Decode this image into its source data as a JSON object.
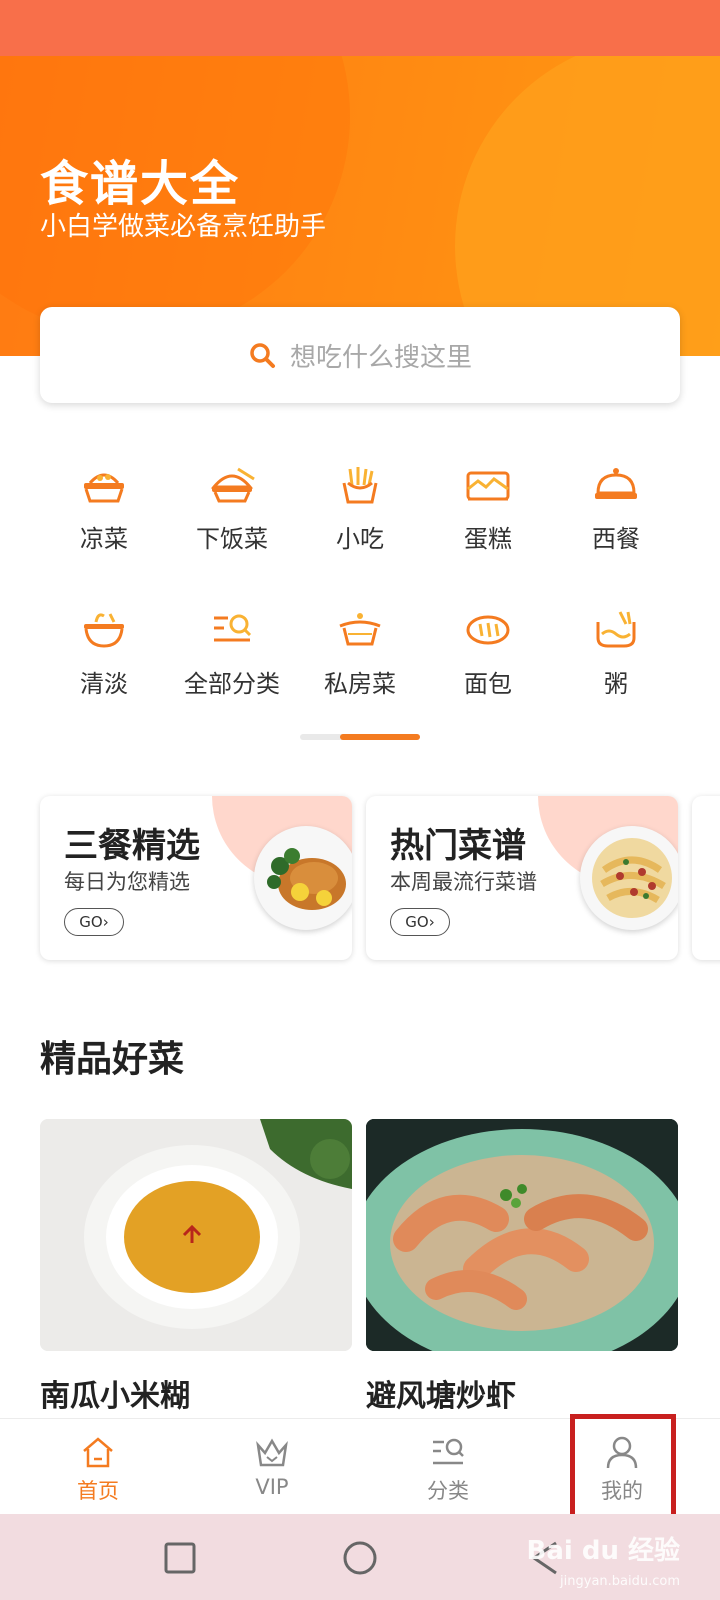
{
  "header": {
    "title": "食谱大全",
    "subtitle": "小白学做菜必备烹饪助手"
  },
  "search": {
    "placeholder": "想吃什么搜这里"
  },
  "categories": [
    {
      "label": "凉菜",
      "icon": "cold-dish-icon"
    },
    {
      "label": "下饭菜",
      "icon": "rice-dish-icon"
    },
    {
      "label": "小吃",
      "icon": "fries-snack-icon"
    },
    {
      "label": "蛋糕",
      "icon": "cake-icon"
    },
    {
      "label": "西餐",
      "icon": "cloche-icon"
    },
    {
      "label": "清淡",
      "icon": "light-bowl-icon"
    },
    {
      "label": "全部分类",
      "icon": "category-list-icon"
    },
    {
      "label": "私房菜",
      "icon": "pot-icon"
    },
    {
      "label": "面包",
      "icon": "bread-icon"
    },
    {
      "label": "粥",
      "icon": "porridge-icon"
    }
  ],
  "promos": [
    {
      "title": "三餐精选",
      "subtitle": "每日为您精选",
      "go": "GO›"
    },
    {
      "title": "热门菜谱",
      "subtitle": "本周最流行菜谱",
      "go": "GO›"
    }
  ],
  "featured": {
    "title": "精品好菜",
    "dishes": [
      {
        "name": "南瓜小米糊"
      },
      {
        "name": "避风塘炒虾"
      }
    ]
  },
  "tabbar": {
    "items": [
      {
        "label": "首页",
        "icon": "home-icon",
        "active": true
      },
      {
        "label": "VIP",
        "icon": "crown-icon",
        "active": false
      },
      {
        "label": "分类",
        "icon": "category-list-icon",
        "active": false
      },
      {
        "label": "我的",
        "icon": "person-icon",
        "active": false
      }
    ]
  },
  "watermark": {
    "brand": "Bai du 经验",
    "url": "jingyan.baidu.com"
  },
  "colors": {
    "accent": "#f47b20",
    "hero": "#ff8a12",
    "status_bar": "#f86f4a",
    "highlight": "#c8201f"
  }
}
